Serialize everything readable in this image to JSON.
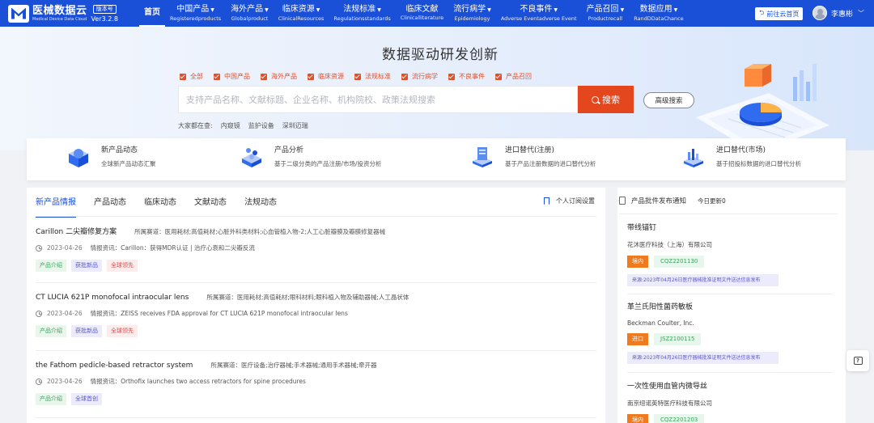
{
  "header": {
    "logo_name": "医械数据云",
    "logo_sub": "Medical Device Data Cloud",
    "version_badge": "版本号",
    "version": "Ver3.2.8",
    "nav": [
      {
        "zh": "首页",
        "en": "",
        "caret": false,
        "active": true
      },
      {
        "zh": "中国产品",
        "en": "Registeredproducts",
        "caret": true
      },
      {
        "zh": "海外产品",
        "en": "Globalproduct",
        "caret": true
      },
      {
        "zh": "临床资源",
        "en": "ClinicalResources",
        "caret": true
      },
      {
        "zh": "法规标准",
        "en": "Regulationsstandards",
        "caret": true
      },
      {
        "zh": "临床文献",
        "en": "Clinicalliterature",
        "caret": false
      },
      {
        "zh": "流行病学",
        "en": "Epidemiology",
        "caret": true
      },
      {
        "zh": "不良事件",
        "en": "Adverse Eventadverse Event",
        "caret": true
      },
      {
        "zh": "产品召回",
        "en": "Productrecall",
        "caret": true
      },
      {
        "zh": "数据应用",
        "en": "RandDDataChance",
        "caret": true
      }
    ],
    "cloud_button": "前往云首页",
    "user_name": "李惠彬"
  },
  "hero": {
    "title": "数据驱动研发创新",
    "filters": [
      "全部",
      "中国产品",
      "海外产品",
      "临床资源",
      "法规标准",
      "流行病学",
      "不良事件",
      "产品召回"
    ],
    "search_placeholder": "支持产品名称、文献标题、企业名称、机构院校、政策法规搜索",
    "search_button": "搜索",
    "advanced_button": "高级搜索",
    "hot_label": "大家都在查:",
    "hot_terms": [
      "内窥镜",
      "监护设备",
      "深圳迈瑞"
    ]
  },
  "features": [
    {
      "title": "新产品动态",
      "desc": "全球新产品动态汇聚",
      "icon": "globe-cube-icon"
    },
    {
      "title": "产品分析",
      "desc": "基于二级分类的产品注册/市场/投资分析",
      "icon": "molecule-cube-icon"
    },
    {
      "title": "进口替代(注册)",
      "desc": "基于产品注册数据的进口替代分析",
      "icon": "document-stack-icon"
    },
    {
      "title": "进口替代(市场)",
      "desc": "基于招投标数据的进口替代分析",
      "icon": "bar-chart-cube-icon"
    }
  ],
  "left": {
    "tabs": [
      "新产品情报",
      "产品动态",
      "临床动态",
      "文献动态",
      "法规动态"
    ],
    "subscribe_label": "个人订阅设置",
    "items": [
      {
        "title": "Carillon 二尖瓣修复方案",
        "track": "所属赛道：医用耗材;高值耗材;心脏外科类材料;心血管植入物-2;人工心脏瓣膜及瓣膜修复器械",
        "date": "2023-04-26",
        "info": "情报资讯：Carillon：获得MDR认证 | 治疗心衰和二尖瓣反流",
        "tags": [
          {
            "label": "产品介绍",
            "kind": "green"
          },
          {
            "label": "获批新品",
            "kind": "blue"
          },
          {
            "label": "全球领先",
            "kind": "red"
          }
        ]
      },
      {
        "title": "CT LUCIA 621P monofocal intraocular lens",
        "track": "所属赛道：医用耗材;高值耗材;眼科材料;眼科植入物及辅助器械;人工晶状体",
        "date": "2023-04-26",
        "info": "情报资讯：ZEISS receives FDA approval for CT LUCIA 621P monofocal intraocular lens",
        "tags": [
          {
            "label": "产品介绍",
            "kind": "green"
          },
          {
            "label": "获批新品",
            "kind": "blue"
          },
          {
            "label": "全球领先",
            "kind": "red"
          }
        ]
      },
      {
        "title": "the Fathom pedicle-based retractor system",
        "track": "所属赛道：医疗设备;治疗器械;手术器械;通用手术器械;牵开器",
        "date": "2023-04-26",
        "info": "情报资讯：Orthofix launches two access retractors for spine procedures",
        "tags": [
          {
            "label": "产品介绍",
            "kind": "green"
          },
          {
            "label": "全球首创",
            "kind": "blue"
          }
        ]
      }
    ]
  },
  "right": {
    "header": "产品批件发布通知",
    "today": "今日更新0",
    "items": [
      {
        "name": "带线锚钉",
        "company": "花沐医疗科技（上海）有限公司",
        "type": "境内",
        "code": "CQZ2201130",
        "source": "来源:2023年04月26日医疗器械批准证明文件送达信息发布"
      },
      {
        "name": "革兰氏阳性菌药敏板",
        "company": "Beckman Coulter, Inc.",
        "type": "进口",
        "code": "JSZ2100115",
        "source": "来源:2023年04月26日医疗器械批准证明文件送达信息发布"
      },
      {
        "name": "一次性使用血管内微导丝",
        "company": "南京纽诺英特医疗科技有限公司",
        "type": "境内",
        "code": "CQZ2201203",
        "source": ""
      }
    ]
  },
  "colors": {
    "brand": "#1a4fd8",
    "accent": "#e4461d",
    "tab_active": "#1a4fd8"
  }
}
